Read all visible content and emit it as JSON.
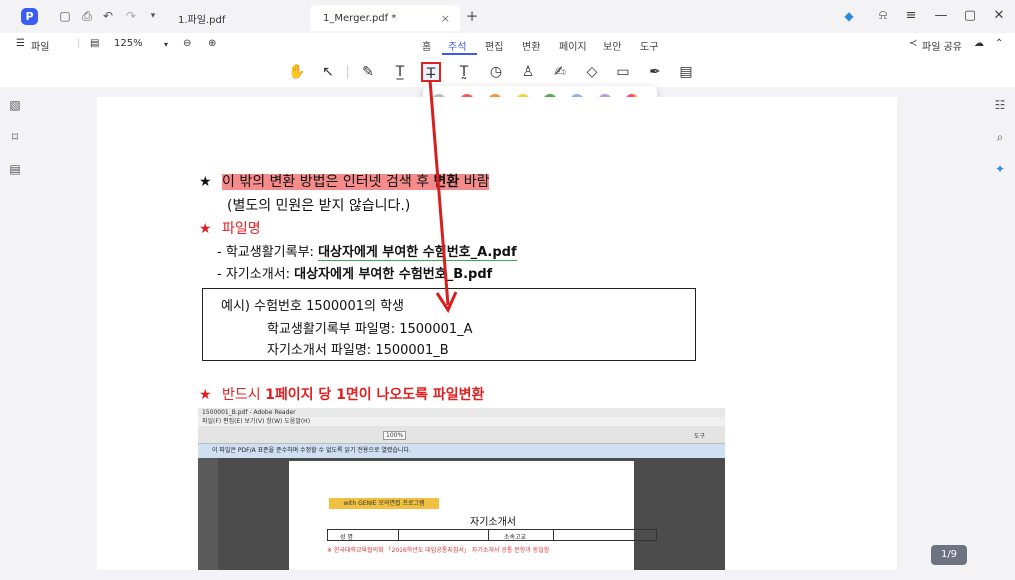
{
  "window": {
    "tabs": [
      {
        "label": "1.파일.pdf"
      },
      {
        "label": "1_Merger.pdf *",
        "active": true
      }
    ],
    "new_tab": "+",
    "close": "×"
  },
  "menubar": {
    "file_label": "파일",
    "zoom": "125%",
    "tabs": [
      "홈",
      "주석",
      "편집",
      "변환",
      "페이지",
      "보안",
      "도구"
    ],
    "active_tab": "주석",
    "share_label": "파일 공유"
  },
  "palette": {
    "colors": [
      "#b9b9b9",
      "#f05a5a",
      "#f59a3a",
      "#f3d23a",
      "#4caf50",
      "#8fb0ee",
      "#b89ae8"
    ]
  },
  "document": {
    "line1": "이 밖의 변환 방법은 인터넷 검색 후 ",
    "line1_bold": "변환",
    "line1_end": " 바람",
    "line2": "(별도의 민원은 받지 않습니다.)",
    "heading_filename": "파일명",
    "item1_prefix": "- 학교생활기록부: ",
    "item1_value": "대상자에게 부여한 수험번호_A.pdf",
    "item2_prefix": "- 자기소개서: ",
    "item2_value": "대상자에게 부여한 수험번호_B.pdf",
    "example_title": "예시) 수험번호 1500001의 학생",
    "example_a": "학교생활기록부 파일명: 1500001_A",
    "example_b": "자기소개서 파일명: 1500001_B",
    "heading_must_prefix": "반드시 ",
    "heading_must_bold": "1페이지 당 1면이 나오도록 파일변환",
    "star": "★"
  },
  "embed": {
    "title": "1500001_B.pdf - Adobe Reader",
    "menu": "파일(F)  편집(E)  보기(V)  창(W)  도움말(H)",
    "zoom": "100%",
    "tools_label": "도구",
    "info": "이 파일은 PDF/A 표준을 준수하며 수정할 수 없도록 읽기 전용으로 열렸습니다.",
    "tag": "with GENIE 모의면접 프로그램",
    "heading": "자기소개서",
    "table_name_label": "성    명",
    "table_school_label": "소속고교",
    "note": "※ 한국대학교육협의회 「2016학년도 대입공통지침서」 자기소개서 공통 문항과 동일함"
  },
  "page_indicator": "1/9"
}
